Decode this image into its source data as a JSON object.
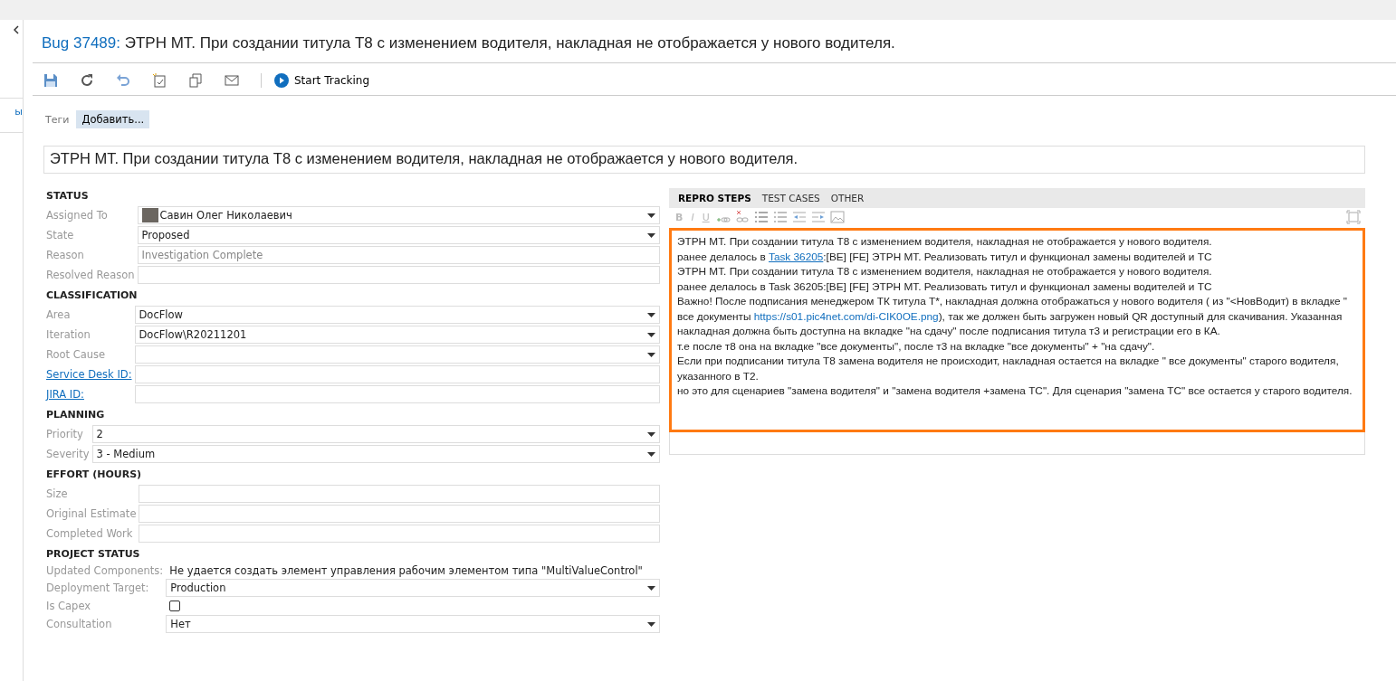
{
  "sidebar": {
    "fragment": "ы"
  },
  "header": {
    "item_type": "Bug 37489:",
    "title": "ЭТРН МТ. При создании титула Т8 с изменением водителя, накладная не отображается у нового водителя."
  },
  "toolbar": {
    "tracking_label": "Start Tracking"
  },
  "tags": {
    "label": "Теги",
    "add": "Добавить..."
  },
  "title_field": {
    "value": "ЭТРН МТ. При создании титула Т8 с изменением водителя, накладная не отображается у нового водителя."
  },
  "sections": [
    {
      "title": "STATUS",
      "fields": [
        {
          "label": "Assigned To",
          "kind": "person",
          "value": "Савин Олег Николаевич",
          "link": false
        },
        {
          "label": "State",
          "kind": "select",
          "value": "Proposed",
          "link": false
        },
        {
          "label": "Reason",
          "kind": "readonly",
          "value": "Investigation Complete",
          "link": false
        },
        {
          "label": "Resolved Reason",
          "kind": "text",
          "link": false
        }
      ]
    },
    {
      "title": "CLASSIFICATION",
      "fields": [
        {
          "label": "Area",
          "kind": "select",
          "value": "DocFlow",
          "link": false
        },
        {
          "label": "Iteration",
          "kind": "select",
          "value": "DocFlow\\R20211201",
          "link": false
        },
        {
          "label": "Root Cause",
          "kind": "select",
          "link": false
        },
        {
          "label": "Service Desk ID:",
          "kind": "text",
          "link": true
        },
        {
          "label": "JIRA ID:",
          "kind": "text",
          "link": true
        }
      ]
    },
    {
      "title": "PLANNING",
      "fields": [
        {
          "label": "Priority",
          "kind": "select",
          "value": "2",
          "link": false
        },
        {
          "label": "Severity",
          "kind": "select",
          "value": "3 - Medium",
          "link": false
        }
      ]
    },
    {
      "title": "EFFORT (HOURS)",
      "fields": [
        {
          "label": "Size",
          "kind": "text",
          "link": false
        },
        {
          "label": "Original Estimate",
          "kind": "text",
          "link": false
        },
        {
          "label": "Completed Work",
          "kind": "text",
          "link": false
        }
      ]
    },
    {
      "title": "PROJECT STATUS",
      "fields": [
        {
          "label": "Updated Components:",
          "kind": "message",
          "value": "Не удается создать элемент управления рабочим элементом типа \"MultiValueControl\"",
          "link": false
        },
        {
          "label": "Deployment Target:",
          "kind": "select",
          "value": "Production",
          "link": false
        },
        {
          "label": "Is Capex",
          "kind": "checkbox",
          "checked": false,
          "link": false
        },
        {
          "label": "Consultation",
          "kind": "select",
          "value": "Нет",
          "link": false
        }
      ]
    }
  ],
  "tabs": [
    {
      "label": "REPRO STEPS",
      "selected": true
    },
    {
      "label": "TEST CASES",
      "selected": false
    },
    {
      "label": "OTHER",
      "selected": false
    }
  ],
  "format_buttons": [
    "B",
    "I",
    "U"
  ],
  "repro_steps": [
    [
      {
        "text": "ЭТРН МТ. При создании титула Т8 с изменением водителя, накладная не отображается у нового водителя.",
        "kind": "plain"
      }
    ],
    [
      {
        "text": "ранее делалось в ",
        "kind": "plain"
      },
      {
        "text": " Task 36205",
        "kind": "link"
      },
      {
        "text": ":[BE] [FE] ЭТРН МТ. Реализовать титул и функционал замены водителей и ТС",
        "kind": "plain"
      }
    ],
    [
      {
        "text": "ЭТРН МТ. При создании титула Т8 с изменением водителя, накладная не отображается у нового водителя.",
        "kind": "plain"
      }
    ],
    [
      {
        "text": "ранее делалось в  Task 36205:[BE] [FE] ЭТРН МТ. Реализовать титул и функционал замены водителей и ТС",
        "kind": "plain"
      }
    ],
    [
      {
        "text": "Важно! После подписания менеджером ТК титула Т*, накладная должна отображаться у нового водителя ( из \"<НовВодит) в вкладке \" все документы ",
        "kind": "plain"
      },
      {
        "text": "https://s01.pic4net.com/di-CIK0OE.png",
        "kind": "url"
      },
      {
        "text": "), так же должен быть загружен новый QR доступный для скачивания. Указанная накладная должна быть доступна на вкладке \"на сдачу\" после подписания титула т3 и регистрации его в КА.",
        "kind": "plain"
      }
    ],
    [
      {
        "text": "т.е после т8 она на вкладке \"все документы\", после т3 на вкладке \"все документы\" + \"на сдачу\".",
        "kind": "plain"
      }
    ],
    [
      {
        "text": "Если при подписании титула Т8 замена водителя не происходит, накладная остается на вкладке  \" все документы\" старого водителя, указанного в Т2.",
        "kind": "plain"
      }
    ],
    [
      {
        "text": "но это для сценариев \"замена водителя\" и \"замена водителя +замена ТС\". Для сценария \"замена ТС\" все остается у старого водителя.",
        "kind": "plain"
      }
    ]
  ]
}
